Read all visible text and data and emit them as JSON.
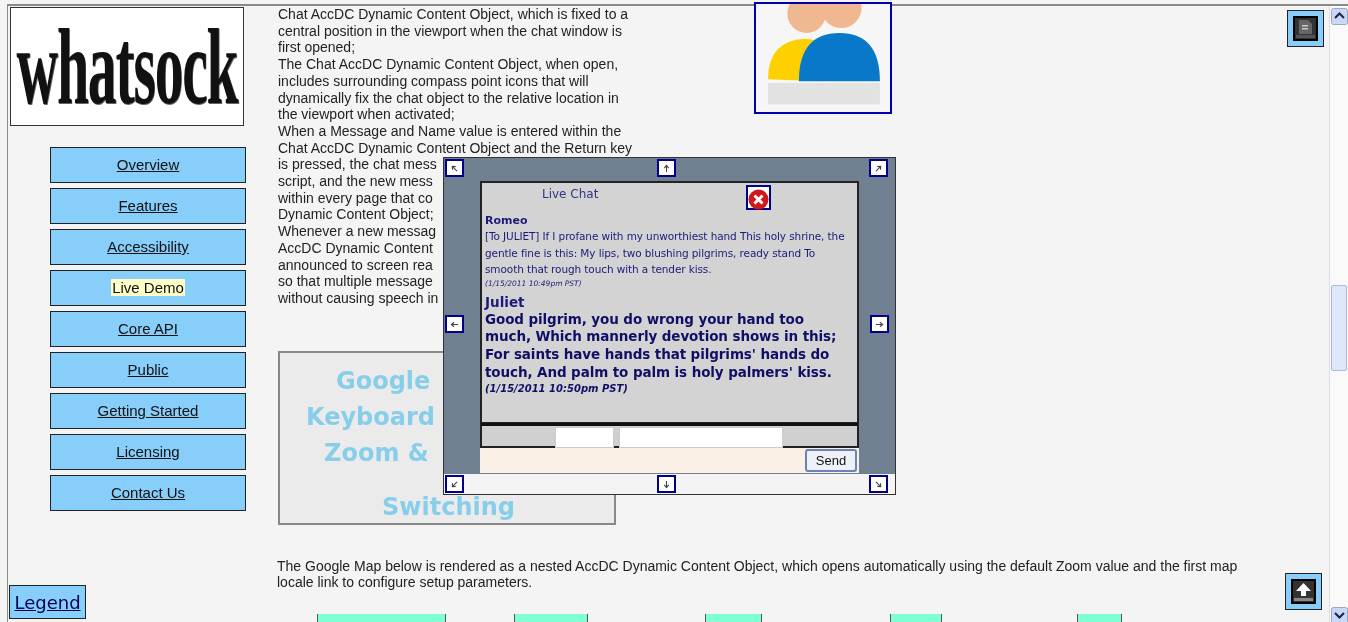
{
  "logo": {
    "text": "whatsock"
  },
  "nav": [
    {
      "label": "Overview",
      "selected": false
    },
    {
      "label": "Features",
      "selected": false
    },
    {
      "label": "Accessibility",
      "selected": false
    },
    {
      "label": "Live Demo",
      "selected": true
    },
    {
      "label": "Core API",
      "selected": false
    },
    {
      "label": "Public",
      "selected": false
    },
    {
      "label": "Getting Started",
      "selected": false
    },
    {
      "label": "Licensing",
      "selected": false
    },
    {
      "label": "Contact Us",
      "selected": false
    }
  ],
  "intro_lines": [
    "Chat AccDC Dynamic Content Object, which is fixed to a",
    "central position in the viewport when the chat window is",
    "first opened;",
    "The Chat AccDC Dynamic Content Object, when open,",
    "includes surrounding compass point icons that will",
    "dynamically fix the chat object to the relative location in",
    "the viewport when activated;",
    "When a Message and Name value is entered within the",
    "Chat AccDC Dynamic Content Object and the Return key",
    "is pressed, the chat mess",
    "script, and the new mess",
    "within every page that co",
    "Dynamic Content Object;",
    "Whenever a new messag",
    "AccDC Dynamic Content",
    "announced to screen rea",
    "so that multiple message",
    "without causing speech in"
  ],
  "map_banner": {
    "lines": [
      "Google",
      "Keyboard",
      "Zoom &",
      "Switching"
    ]
  },
  "map_description": "The Google Map below is rendered as a nested AccDC Dynamic Content Object, which opens automatically using the default Zoom value and the first map locale link to configure setup parameters.",
  "legend_button": "Legend",
  "chat": {
    "title": "Live Chat",
    "messages": [
      {
        "kind": "small",
        "author": "Romeo",
        "text": "[To JULIET] If I profane with my unworthiest hand This holy shrine, the gentle fine is this: My lips, two blushing pilgrims, ready stand To smooth that rough touch with a tender kiss.",
        "time": "(1/15/2011 10:49pm PST)"
      },
      {
        "kind": "large",
        "author": "Juliet",
        "text": "Good pilgrim, you do wrong your hand too much, Which mannerly devotion shows in this; For saints have hands that pilgrims' hands do touch, And palm to palm is holy palmers' kiss.",
        "time": "(1/15/2011 10:50pm PST)"
      }
    ],
    "send_label": "Send"
  }
}
